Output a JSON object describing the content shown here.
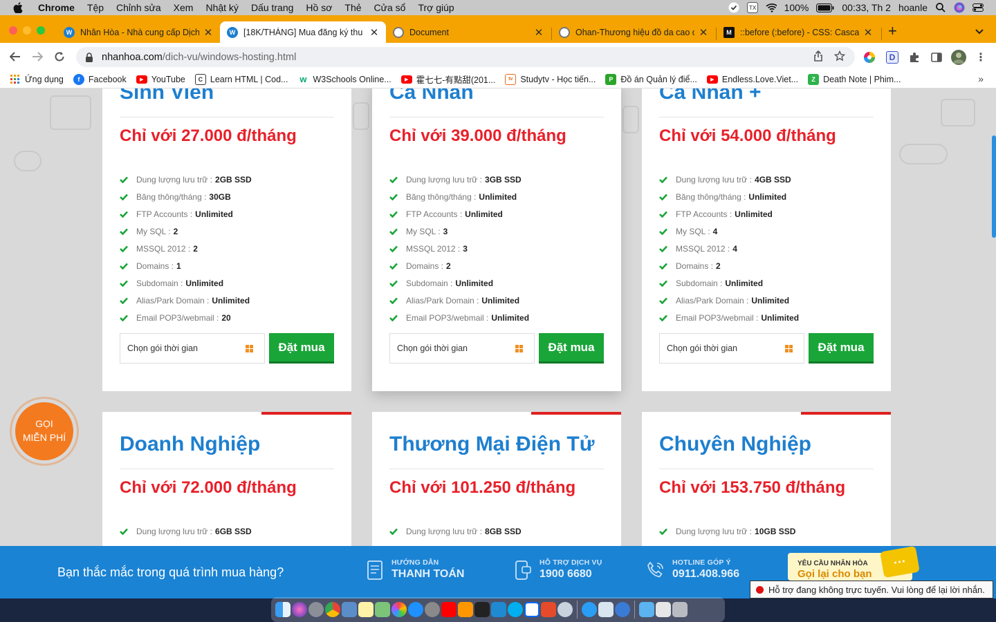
{
  "menubar": {
    "app": "Chrome",
    "items": [
      "Tệp",
      "Chỉnh sửa",
      "Xem",
      "Nhật ký",
      "Dấu trang",
      "Hồ sơ",
      "Thẻ",
      "Cửa sổ",
      "Trợ giúp"
    ],
    "battery": "100%",
    "clock": "00:33, Th 2",
    "user": "hoanle"
  },
  "tabs": [
    {
      "title": "Nhân Hòa - Nhà cung cấp Dịch",
      "fav_color": "#1e7fcf",
      "fav_text": "W",
      "active": false
    },
    {
      "title": "[18K/THÁNG] Mua đăng ký thu",
      "fav_color": "#1e7fcf",
      "fav_text": "W",
      "active": true
    },
    {
      "title": "Document",
      "fav_color": "#888888",
      "fav_text": "",
      "active": false
    },
    {
      "title": "Ohan-Thương hiệu đồ da cao c",
      "fav_color": "#888888",
      "fav_text": "",
      "active": false
    },
    {
      "title": "::before (:before) - CSS: Casca",
      "fav_color": "#111111",
      "fav_text": "M",
      "active": false
    }
  ],
  "address": {
    "host": "nhanhoa.com",
    "path": "/dich-vu/windows-hosting.html"
  },
  "bookmarks": [
    {
      "label": "Ứng dụng",
      "icon": "apps-grid-icon",
      "color": "#e8a000"
    },
    {
      "label": "Facebook",
      "icon": "facebook-icon",
      "color": "#1877f2"
    },
    {
      "label": "YouTube",
      "icon": "youtube-icon",
      "color": "#ff0000"
    },
    {
      "label": "Learn HTML | Cod...",
      "icon": "codecademy-icon",
      "color": "#333333"
    },
    {
      "label": "W3Schools Online...",
      "icon": "w3schools-icon",
      "color": "#04aa6d"
    },
    {
      "label": "霍七七-有點甜(201...",
      "icon": "youtube-icon",
      "color": "#ff0000"
    },
    {
      "label": "Studytv - Học tiến...",
      "icon": "studytv-icon",
      "color": "#e86a1a"
    },
    {
      "label": "Đồ án Quản lý điể...",
      "icon": "project-icon",
      "color": "#2aa52a"
    },
    {
      "label": "Endless.Love.Viet...",
      "icon": "youtube-icon",
      "color": "#ff0000"
    },
    {
      "label": "Death Note | Phim...",
      "icon": "zing-icon",
      "color": "#2db34a"
    }
  ],
  "plans_top": [
    {
      "title": "Sinh Viên",
      "price": "Chỉ với 27.000 đ/tháng",
      "features": [
        {
          "label": "Dung lượng lưu trữ :",
          "value": "2GB SSD"
        },
        {
          "label": "Băng thông/tháng :",
          "value": "30GB"
        },
        {
          "label": "FTP Accounts :",
          "value": "Unlimited"
        },
        {
          "label": "My SQL :",
          "value": "2"
        },
        {
          "label": "MSSQL 2012 :",
          "value": "2"
        },
        {
          "label": "Domains :",
          "value": "1"
        },
        {
          "label": "Subdomain :",
          "value": "Unlimited"
        },
        {
          "label": "Alias/Park Domain :",
          "value": "Unlimited"
        },
        {
          "label": "Email POP3/webmail :",
          "value": "20"
        }
      ]
    },
    {
      "title": "Cá Nhân",
      "price": "Chỉ với 39.000 đ/tháng",
      "features": [
        {
          "label": "Dung lượng lưu trữ :",
          "value": "3GB SSD"
        },
        {
          "label": "Băng thông/tháng :",
          "value": "Unlimited"
        },
        {
          "label": "FTP Accounts :",
          "value": "Unlimited"
        },
        {
          "label": "My SQL :",
          "value": "3"
        },
        {
          "label": "MSSQL 2012 :",
          "value": "3"
        },
        {
          "label": "Domains :",
          "value": "2"
        },
        {
          "label": "Subdomain :",
          "value": "Unlimited"
        },
        {
          "label": "Alias/Park Domain :",
          "value": "Unlimited"
        },
        {
          "label": "Email POP3/webmail :",
          "value": "Unlimited"
        }
      ]
    },
    {
      "title": "Cá Nhân +",
      "price": "Chỉ với 54.000 đ/tháng",
      "features": [
        {
          "label": "Dung lượng lưu trữ :",
          "value": "4GB SSD"
        },
        {
          "label": "Băng thông/tháng :",
          "value": "Unlimited"
        },
        {
          "label": "FTP Accounts :",
          "value": "Unlimited"
        },
        {
          "label": "My SQL :",
          "value": "4"
        },
        {
          "label": "MSSQL 2012 :",
          "value": "4"
        },
        {
          "label": "Domains :",
          "value": "2"
        },
        {
          "label": "Subdomain :",
          "value": "Unlimited"
        },
        {
          "label": "Alias/Park Domain :",
          "value": "Unlimited"
        },
        {
          "label": "Email POP3/webmail :",
          "value": "Unlimited"
        }
      ]
    }
  ],
  "plans_bottom": [
    {
      "title": "Doanh Nghiệp",
      "price": "Chỉ với 72.000 đ/tháng",
      "first_feature": {
        "label": "Dung lượng lưu trữ :",
        "value": "6GB SSD"
      }
    },
    {
      "title": "Thương Mại Điện Tử",
      "price": "Chỉ với 101.250 đ/tháng",
      "first_feature": {
        "label": "Dung lượng lưu trữ :",
        "value": "8GB SSD"
      }
    },
    {
      "title": "Chuyên Nghiệp",
      "price": "Chỉ với 153.750 đ/tháng",
      "first_feature": {
        "label": "Dung lượng lưu trữ :",
        "value": "10GB SSD"
      }
    }
  ],
  "select_placeholder": "Chọn gói thời gian",
  "buy_label": "Đặt mua",
  "call_free": "GỌI MIỄN PHÍ",
  "support": {
    "question": "Bạn thắc mắc trong quá trình mua hàng?",
    "items": [
      {
        "small": "HƯỚNG DẪN",
        "large": "THANH TOÁN",
        "icon": "document-icon"
      },
      {
        "small": "HỖ TRỢ DỊCH VỤ",
        "large": "1900 6680",
        "icon": "mobile-support-icon"
      },
      {
        "small": "HOTLINE GÓP Ý",
        "large": "0911.408.966",
        "icon": "phone-icon"
      }
    ],
    "callback_small": "YÊU CẦU NHÂN HÒA",
    "callback_large": "Gọi lại cho bạn",
    "offline": "Hỗ trợ đang không trực tuyến. Vui lòng để lại lời nhắn."
  },
  "colors": {
    "tabbar": "#f4a300",
    "title_blue": "#1e7fcf",
    "price_red": "#e8202a",
    "buy_green": "#19a538",
    "support_blue": "#1a83d4"
  }
}
